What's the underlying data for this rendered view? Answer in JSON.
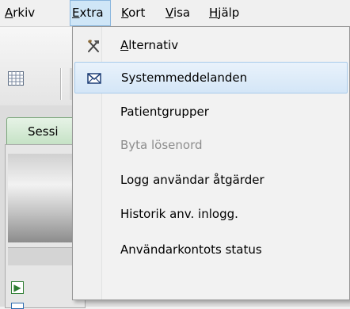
{
  "menubar": {
    "items": [
      {
        "label_u": "A",
        "label_rest": "rkiv"
      },
      {
        "label_u": "E",
        "label_rest": "xtra"
      },
      {
        "label_u": "K",
        "label_rest": "ort"
      },
      {
        "label_u": "V",
        "label_rest": "isa"
      },
      {
        "label_u": "H",
        "label_rest": "jälp"
      }
    ]
  },
  "background": {
    "tab_label": "Sessi"
  },
  "extra_menu": {
    "items": [
      {
        "icon": "tools-icon",
        "label_u": "A",
        "label_rest": "lternativ",
        "enabled": true
      },
      {
        "icon": "envelope-icon",
        "label": "Systemmeddelanden",
        "enabled": true,
        "highlighted": true
      },
      {
        "label": "Patientgrupper",
        "enabled": true
      },
      {
        "label": "Byta lösenord",
        "enabled": false
      },
      {
        "label": "Logg användar åtgärder",
        "enabled": true
      },
      {
        "label": "Historik anv. inlogg.",
        "enabled": true
      },
      {
        "label": "Användarkontots status",
        "enabled": true
      }
    ]
  },
  "colors": {
    "highlight": "#d4e6f7",
    "disabled_text": "#8d8d8d",
    "tab_green": "#c6e2c6"
  }
}
